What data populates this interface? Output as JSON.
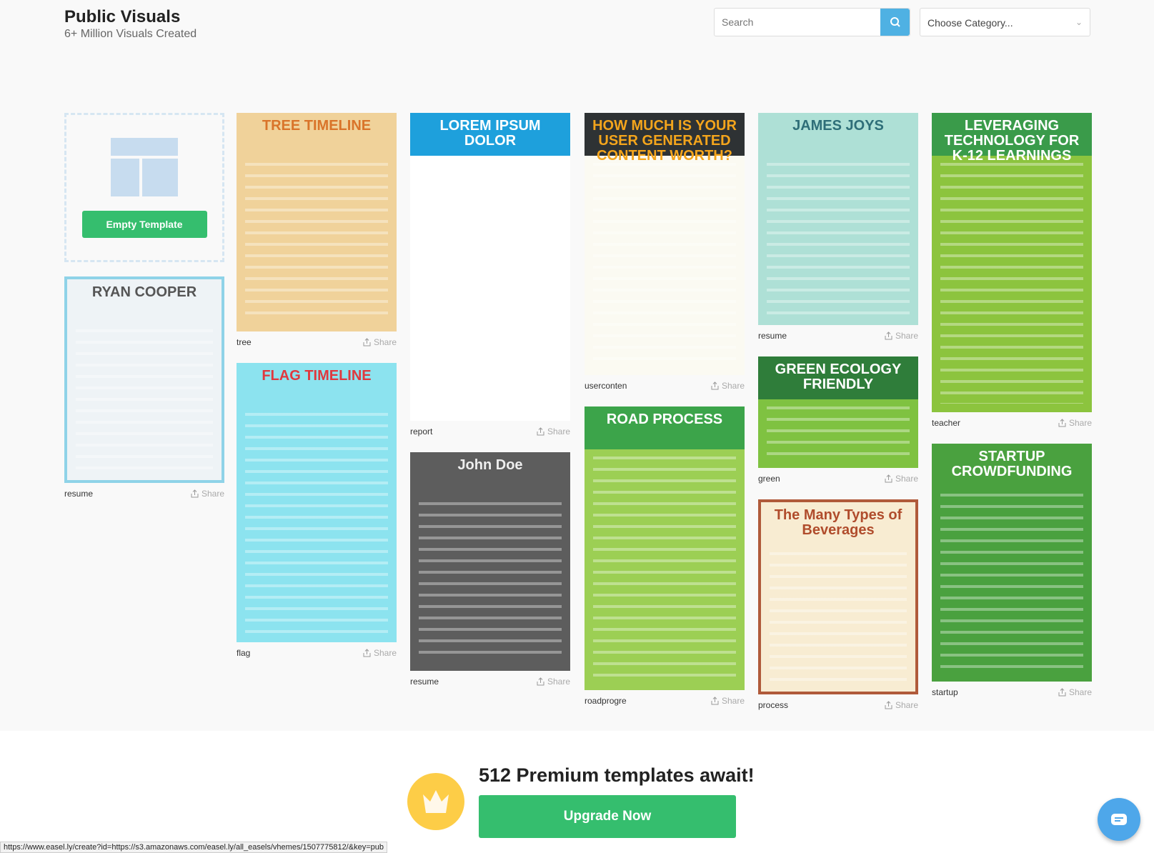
{
  "header": {
    "title": "Public Visuals",
    "subtitle": "6+ Million Visuals Created",
    "search_placeholder": "Search",
    "category_placeholder": "Choose Category..."
  },
  "empty_template": {
    "label": "Empty Template"
  },
  "share_label": "Share",
  "columns": [
    [
      {
        "name": "resume",
        "thumb_title": "RYAN COOPER",
        "bg": "#eef3f6",
        "fg": "#555",
        "border": "#8fd3e8",
        "h": 289
      }
    ],
    [
      {
        "name": "tree",
        "thumb_title": "TREE TIMELINE",
        "bg": "#f0d29a",
        "fg": "#d9742a",
        "h": 306
      },
      {
        "name": "flag",
        "thumb_title": "FLAG TIMELINE",
        "bg": "#8ce3ef",
        "fg": "#e0383e",
        "h": 391
      }
    ],
    [
      {
        "name": "report",
        "thumb_title": "LOREM IPSUM DOLOR",
        "bg": "#ffffff",
        "fg": "#ffffff",
        "head": "#1ea0dc",
        "h": 431
      },
      {
        "name": "resume",
        "thumb_title": "John Doe",
        "bg": "#5d5d5d",
        "fg": "#eee",
        "h": 306
      }
    ],
    [
      {
        "name": "userconten",
        "thumb_title": "HOW MUCH IS YOUR USER GENERATED CONTENT WORTH?",
        "bg": "#fbfaf2",
        "fg": "#f4a51c",
        "head": "#2e3234",
        "h": 367
      },
      {
        "name": "roadprogre",
        "thumb_title": "ROAD PROCESS",
        "bg": "#9ccf54",
        "fg": "#ffffff",
        "head": "#3ca44a",
        "h": 397
      }
    ],
    [
      {
        "name": "resume",
        "thumb_title": "JAMES JOYS",
        "bg": "#aee0d6",
        "fg": "#2e6e78",
        "h": 297
      },
      {
        "name": "green",
        "thumb_title": "GREEN ECOLOGY FRIENDLY",
        "bg": "#7fc241",
        "fg": "#ffffff",
        "head": "#2f7d3a",
        "h": 156
      },
      {
        "name": "process",
        "thumb_title": "The Many Types of Beverages",
        "bg": "#f8ecd2",
        "fg": "#b04c2c",
        "border": "#b05a3a",
        "h": 273
      }
    ],
    [
      {
        "name": "teacher",
        "thumb_title": "LEVERAGING TECHNOLOGY FOR K-12 LEARNINGS",
        "bg": "#8cc43e",
        "fg": "#ffffff",
        "head": "#3a9b4a",
        "h": 419
      },
      {
        "name": "startup",
        "thumb_title": "STARTUP CROWDFUNDING",
        "bg": "#4aa13f",
        "fg": "#ffffff",
        "h": 333
      }
    ]
  ],
  "promo": {
    "text": "512 Premium templates await!",
    "button": "Upgrade Now"
  },
  "status_url": "https://www.easel.ly/create?id=https://s3.amazonaws.com/easel.ly/all_easels/vhemes/1507775812/&key=pub"
}
